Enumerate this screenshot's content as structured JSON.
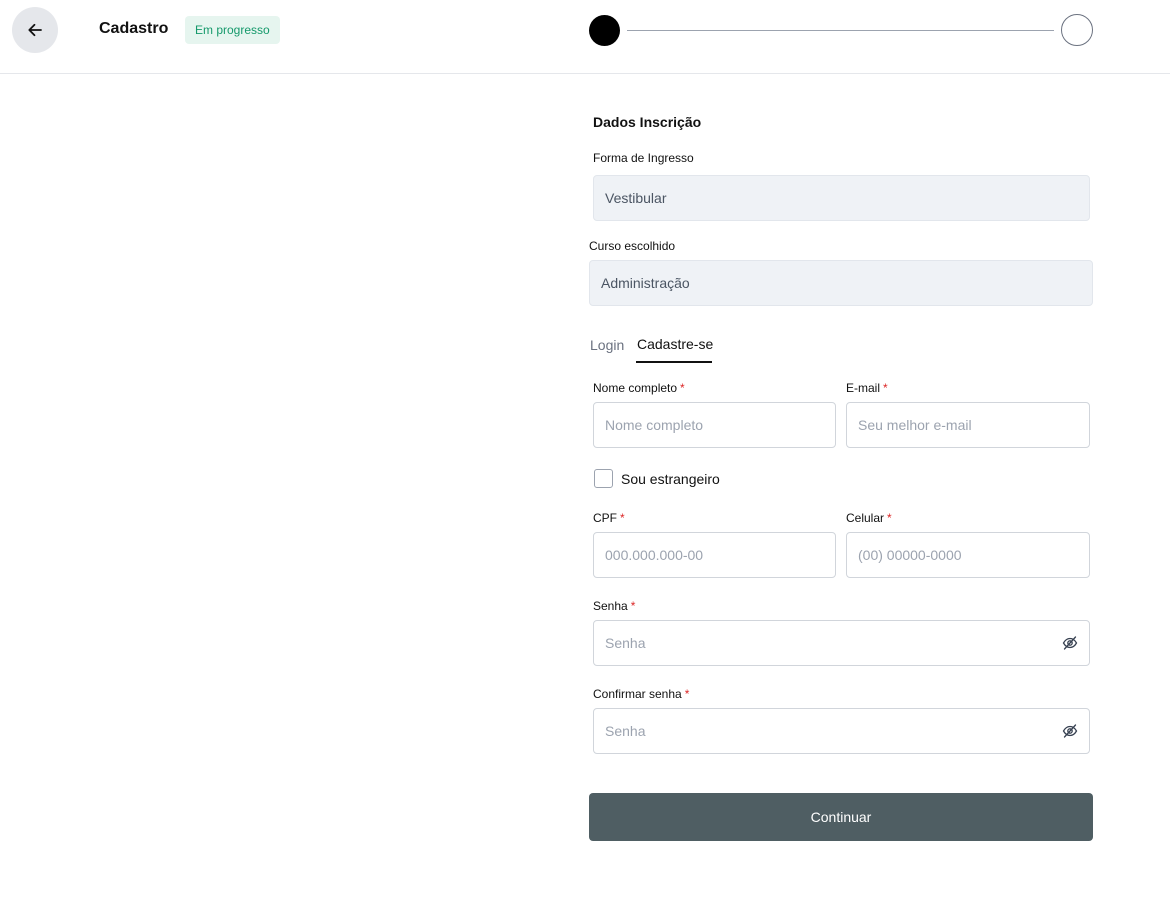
{
  "header": {
    "title": "Cadastro",
    "status_badge": "Em progresso",
    "progress": {
      "steps_total": 2,
      "steps_completed": 1
    }
  },
  "form": {
    "section_title": "Dados Inscrição",
    "forma_ingresso": {
      "label": "Forma de Ingresso",
      "value": "Vestibular"
    },
    "curso": {
      "label": "Curso escolhido",
      "value": "Administração"
    },
    "tabs": [
      {
        "label": "Login",
        "active": false
      },
      {
        "label": "Cadastre-se",
        "active": true
      }
    ],
    "nome": {
      "label": "Nome completo",
      "required": "*",
      "placeholder": "Nome completo"
    },
    "email": {
      "label": "E-mail",
      "required": "*",
      "placeholder": "Seu melhor e-mail"
    },
    "estrangeiro": {
      "label": "Sou estrangeiro",
      "checked": false
    },
    "cpf": {
      "label": "CPF",
      "required": "*",
      "placeholder": "000.000.000-00"
    },
    "celular": {
      "label": "Celular",
      "required": "*",
      "placeholder": "(00) 00000-0000"
    },
    "senha": {
      "label": "Senha",
      "required": "*",
      "placeholder": "Senha"
    },
    "confirmar_senha": {
      "label": "Confirmar senha",
      "required": "*",
      "placeholder": "Senha"
    },
    "continue_label": "Continuar"
  },
  "colors": {
    "badge_bg": "#e6f5ef",
    "badge_text": "#15996b",
    "button_bg": "#4f5e63",
    "required": "#dc2626"
  }
}
